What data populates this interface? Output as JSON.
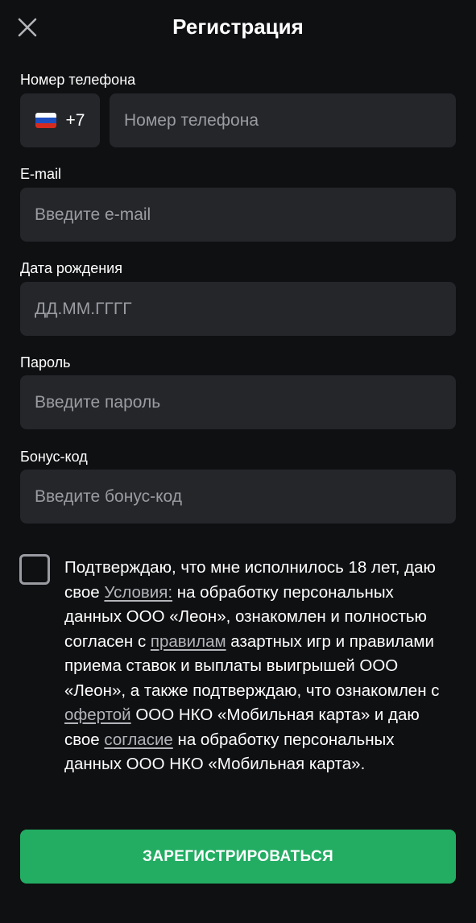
{
  "header": {
    "title": "Регистрация",
    "close_icon": "close-icon"
  },
  "phone": {
    "label": "Номер телефона",
    "country_flag": "russia-flag-icon",
    "flag_colors": [
      "#ffffff",
      "#1f4fbf",
      "#d52b1e"
    ],
    "dial_code": "+7",
    "placeholder": "Номер телефона",
    "value": ""
  },
  "email": {
    "label": "E-mail",
    "placeholder": "Введите e-mail",
    "value": ""
  },
  "birth_date": {
    "label": "Дата рождения",
    "placeholder": "ДД.ММ.ГГГГ",
    "value": ""
  },
  "password": {
    "label": "Пароль",
    "placeholder": "Введите пароль",
    "value": ""
  },
  "bonus_code": {
    "label": "Бонус-код",
    "placeholder": "Введите бонус-код",
    "value": ""
  },
  "consent": {
    "checked": false,
    "text_1": "Подтверждаю, что мне исполнилось 18 лет, даю свое ",
    "link_terms": "Условия:",
    "text_2": " на обработку персональных данных ООО «Леон», ознакомлен и полностью согласен с ",
    "link_rules": "правилам",
    "text_3": " азартных игр и правилами приема ставок и выплаты выигрышей ООО «Леон», а также подтверждаю, что ознакомлен с ",
    "link_offer": "офертой",
    "text_4": " ООО НКО «Мобильная карта» и даю свое ",
    "link_consent": "согласие",
    "text_5": " на обработку персональных данных ООО НКО «Мобильная карта»."
  },
  "submit": {
    "label": "ЗАРЕГИСТРИРОВАТЬСЯ"
  },
  "colors": {
    "background": "#0f1012",
    "input_bg": "#24262a",
    "placeholder": "#9a9ca2",
    "accent": "#22ad63"
  }
}
